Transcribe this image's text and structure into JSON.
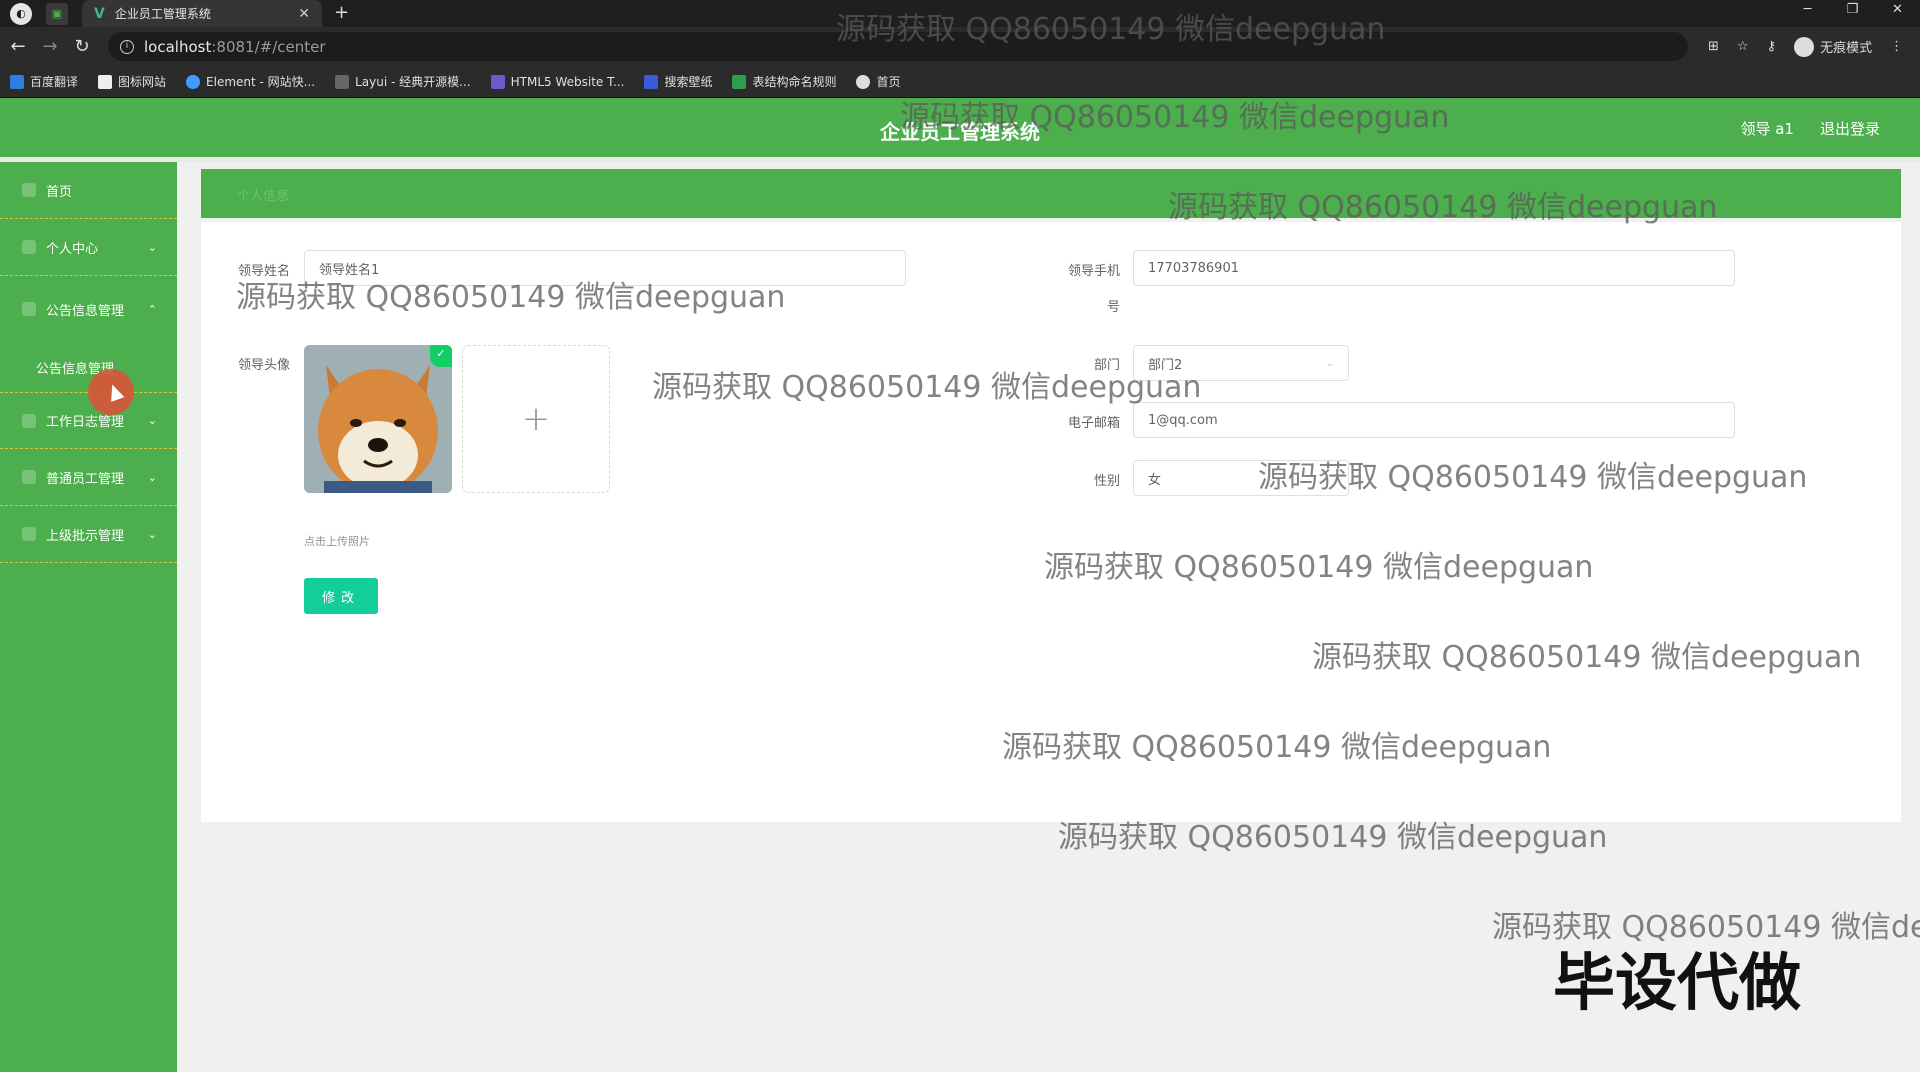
{
  "browser": {
    "tab_title": "企业员工管理系统",
    "url_host": "localhost",
    "url_path": ":8081/#/center",
    "incognito_label": "无痕模式",
    "bookmarks": [
      "百度翻译",
      "图标网站",
      "Element - 网站快...",
      "Layui - 经典开源模...",
      "HTML5 Website T...",
      "搜索壁纸",
      "表结构命名规则",
      "首页"
    ]
  },
  "header": {
    "title": "企业员工管理系统",
    "user": "领导 a1",
    "logout": "退出登录"
  },
  "sidebar": {
    "items": [
      {
        "label": "首页"
      },
      {
        "label": "个人中心"
      },
      {
        "label": "公告信息管理"
      },
      {
        "label": "公告信息管理"
      },
      {
        "label": "工作日志管理"
      },
      {
        "label": "普通员工管理"
      },
      {
        "label": "上级批示管理"
      }
    ]
  },
  "breadcrumb": "个人信息",
  "form": {
    "name_label": "领导姓名",
    "name_value": "领导姓名1",
    "phone_label": "领导手机",
    "phone_label_wrap": "号",
    "phone_value": "17703786901",
    "avatar_label": "领导头像",
    "upload_tip": "点击上传照片",
    "dept_label": "部门",
    "dept_value": "部门2",
    "email_label": "电子邮箱",
    "email_value": "1@qq.com",
    "gender_label": "性别",
    "gender_value": "女",
    "submit_label": "修改"
  },
  "watermark_text": "源码获取 QQ86050149 微信deepguan",
  "watermark_big": "毕设代做"
}
